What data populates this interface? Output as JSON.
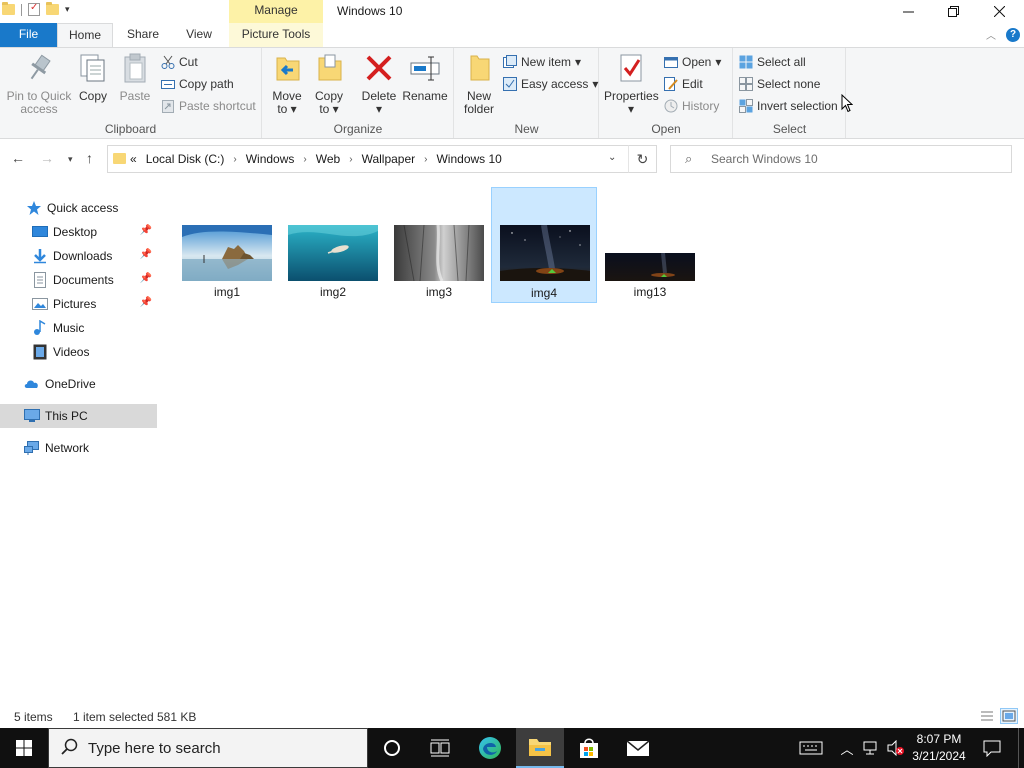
{
  "window": {
    "title": "Windows 10",
    "contextual_tab_group": "Manage"
  },
  "tabs": [
    {
      "label": "File"
    },
    {
      "label": "Home"
    },
    {
      "label": "Share"
    },
    {
      "label": "View"
    },
    {
      "label": "Picture Tools"
    }
  ],
  "ribbon": {
    "clipboard": {
      "label": "Clipboard",
      "pin_line1": "Pin to Quick",
      "pin_line2": "access",
      "copy": "Copy",
      "paste": "Paste",
      "cut": "Cut",
      "copy_path": "Copy path",
      "paste_shortcut": "Paste shortcut"
    },
    "organize": {
      "label": "Organize",
      "move_to_line1": "Move",
      "move_to_line2": "to",
      "copy_to_line1": "Copy",
      "copy_to_line2": "to",
      "delete": "Delete",
      "rename": "Rename"
    },
    "new": {
      "label": "New",
      "new_folder_line1": "New",
      "new_folder_line2": "folder",
      "new_item": "New item",
      "easy_access": "Easy access"
    },
    "open": {
      "label": "Open",
      "properties": "Properties",
      "open": "Open",
      "edit": "Edit",
      "history": "History"
    },
    "select": {
      "label": "Select",
      "select_all": "Select all",
      "select_none": "Select none",
      "invert_selection": "Invert selection"
    }
  },
  "address": {
    "overflow": "«",
    "crumbs": [
      "Local Disk (C:)",
      "Windows",
      "Web",
      "Wallpaper",
      "Windows 10"
    ],
    "search_placeholder": "Search Windows 10"
  },
  "nav": {
    "quick_access": "Quick access",
    "desktop": "Desktop",
    "downloads": "Downloads",
    "documents": "Documents",
    "pictures": "Pictures",
    "music": "Music",
    "videos": "Videos",
    "onedrive": "OneDrive",
    "this_pc": "This PC",
    "network": "Network"
  },
  "files": [
    {
      "name": "img1",
      "selected": false
    },
    {
      "name": "img2",
      "selected": false
    },
    {
      "name": "img3",
      "selected": false
    },
    {
      "name": "img4",
      "selected": true
    },
    {
      "name": "img13",
      "selected": false
    }
  ],
  "status": {
    "item_count": "5 items",
    "selection": "1 item selected",
    "size": "581 KB"
  },
  "taskbar": {
    "search_placeholder": "Type here to search",
    "time": "8:07 PM",
    "date": "3/21/2024"
  },
  "colors": {
    "accent": "#1979ca",
    "selection_bg": "#cce8ff",
    "contextual_tab": "#fdf2a7",
    "taskbar": "#101010"
  }
}
